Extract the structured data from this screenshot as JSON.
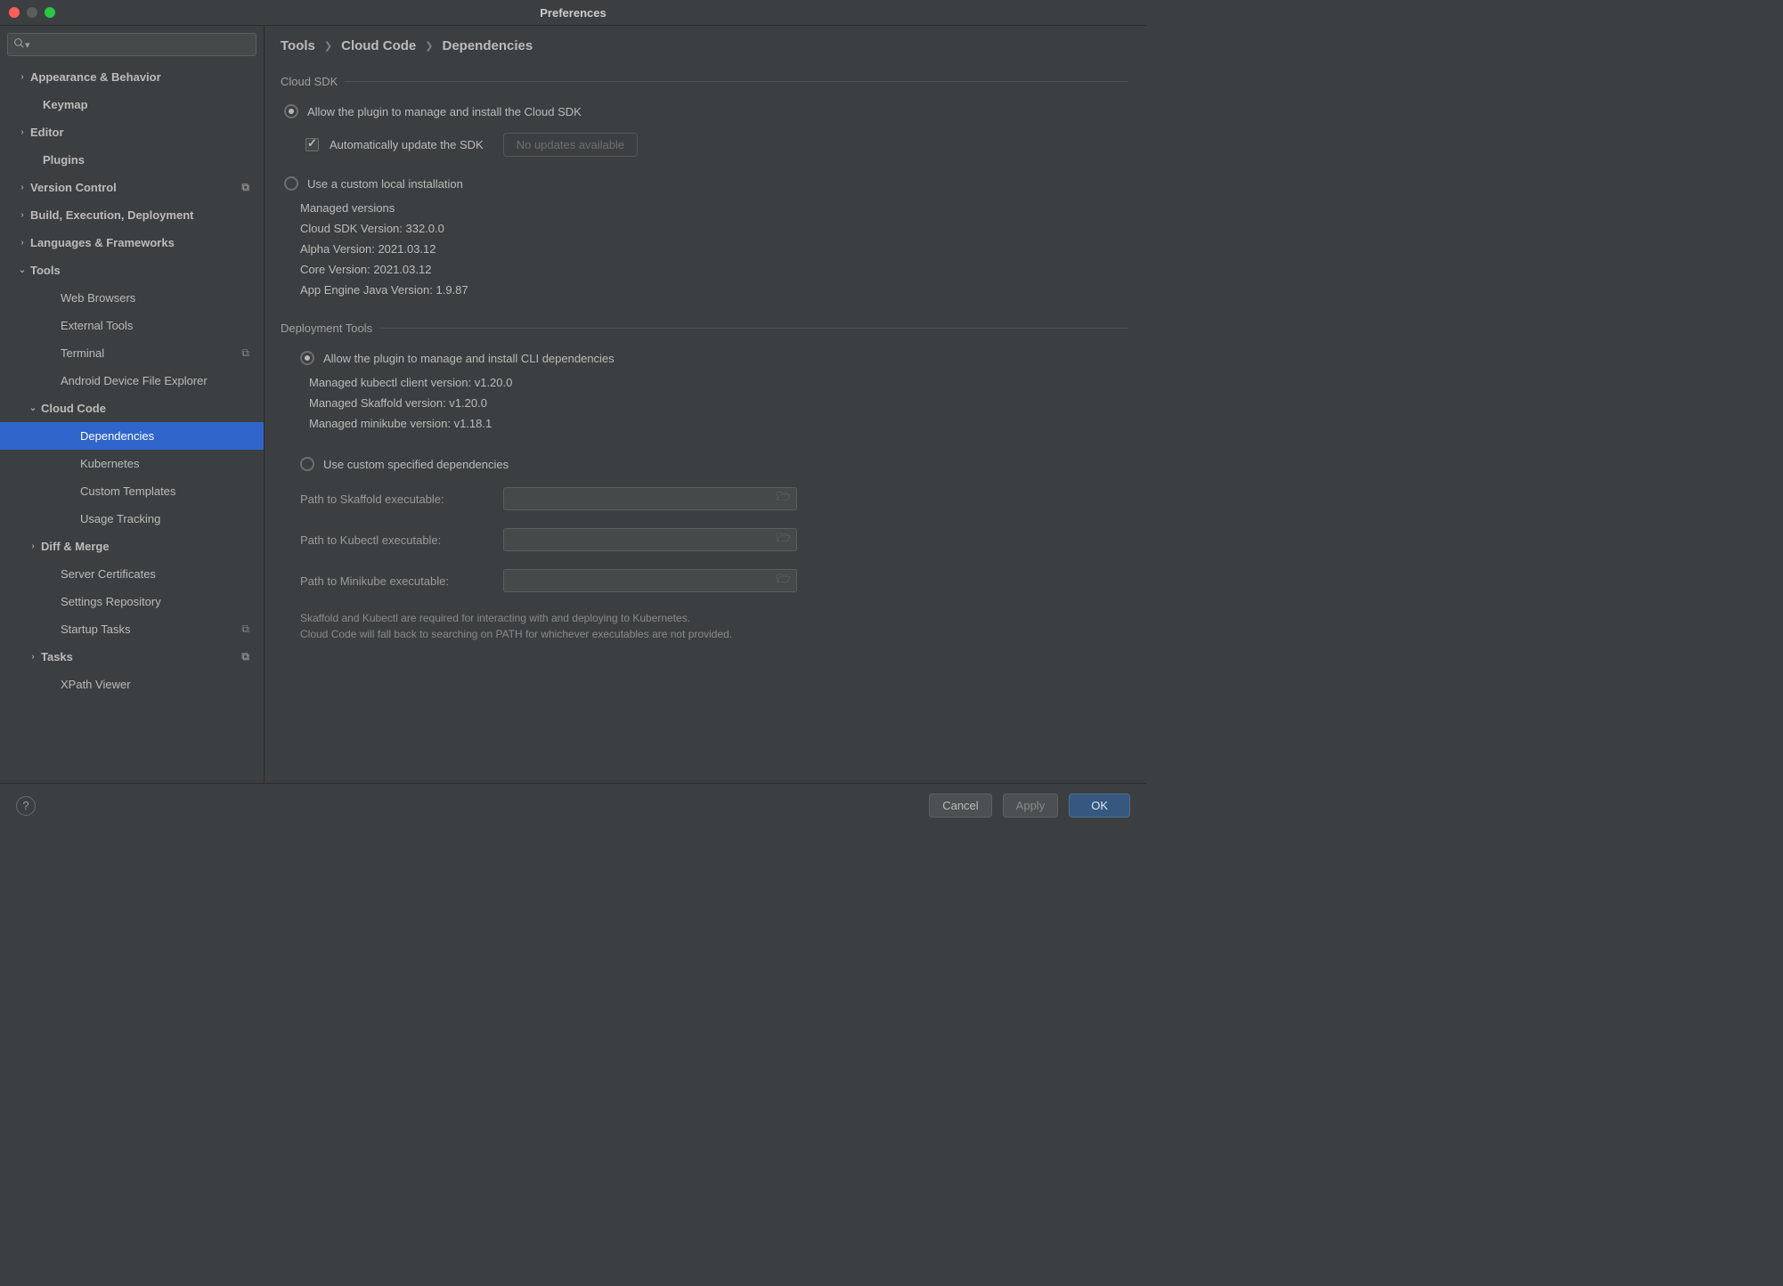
{
  "window": {
    "title": "Preferences"
  },
  "search": {
    "placeholder": ""
  },
  "sidebar": [
    {
      "label": "Appearance & Behavior",
      "level": 1,
      "expand": "right",
      "bold": true
    },
    {
      "label": "Keymap",
      "level": 1,
      "expand": "none",
      "bold": true
    },
    {
      "label": "Editor",
      "level": 1,
      "expand": "right",
      "bold": true
    },
    {
      "label": "Plugins",
      "level": 1,
      "expand": "none",
      "bold": true
    },
    {
      "label": "Version Control",
      "level": 1,
      "expand": "right",
      "bold": true,
      "badge": true
    },
    {
      "label": "Build, Execution, Deployment",
      "level": 1,
      "expand": "right",
      "bold": true
    },
    {
      "label": "Languages & Frameworks",
      "level": 1,
      "expand": "right",
      "bold": true
    },
    {
      "label": "Tools",
      "level": 1,
      "expand": "down",
      "bold": true
    },
    {
      "label": "Web Browsers",
      "level": 2,
      "expand": "none"
    },
    {
      "label": "External Tools",
      "level": 2,
      "expand": "none"
    },
    {
      "label": "Terminal",
      "level": 2,
      "expand": "none",
      "badge": true
    },
    {
      "label": "Android Device File Explorer",
      "level": 2,
      "expand": "none"
    },
    {
      "label": "Cloud Code",
      "level": 2,
      "expand": "down",
      "bold": true
    },
    {
      "label": "Dependencies",
      "level": 3,
      "expand": "none",
      "selected": true
    },
    {
      "label": "Kubernetes",
      "level": 3,
      "expand": "none"
    },
    {
      "label": "Custom Templates",
      "level": 3,
      "expand": "none"
    },
    {
      "label": "Usage Tracking",
      "level": 3,
      "expand": "none"
    },
    {
      "label": "Diff & Merge",
      "level": 2,
      "expand": "right",
      "bold": true
    },
    {
      "label": "Server Certificates",
      "level": 2,
      "expand": "none"
    },
    {
      "label": "Settings Repository",
      "level": 2,
      "expand": "none"
    },
    {
      "label": "Startup Tasks",
      "level": 2,
      "expand": "none",
      "badge": true
    },
    {
      "label": "Tasks",
      "level": 2,
      "expand": "right",
      "bold": true,
      "badge": true
    },
    {
      "label": "XPath Viewer",
      "level": 2,
      "expand": "none"
    }
  ],
  "breadcrumb": [
    "Tools",
    "Cloud Code",
    "Dependencies"
  ],
  "sections": {
    "cloud_sdk": {
      "title": "Cloud SDK",
      "opt_manage": "Allow the plugin to manage and install the Cloud SDK",
      "auto_update": "Automatically update the SDK",
      "update_button": "No updates available",
      "opt_custom": "Use a custom local installation",
      "info": [
        "Managed versions",
        "Cloud SDK Version: 332.0.0",
        "Alpha Version: 2021.03.12",
        "Core Version: 2021.03.12",
        "App Engine Java Version: 1.9.87"
      ]
    },
    "deploy": {
      "title": "Deployment Tools",
      "opt_manage": "Allow the plugin to manage and install CLI dependencies",
      "info": [
        "Managed kubectl client version: v1.20.0",
        "Managed Skaffold version: v1.20.0",
        "Managed minikube version: v1.18.1"
      ],
      "opt_custom": "Use custom specified dependencies",
      "paths": [
        {
          "label": "Path to Skaffold executable:"
        },
        {
          "label": "Path to Kubectl executable:"
        },
        {
          "label": "Path to Minikube executable:"
        }
      ],
      "note1": "Skaffold and Kubectl are required for interacting with and deploying to Kubernetes.",
      "note2": "Cloud Code will fall back to searching on PATH for whichever executables are not provided."
    }
  },
  "footer": {
    "cancel": "Cancel",
    "apply": "Apply",
    "ok": "OK"
  }
}
